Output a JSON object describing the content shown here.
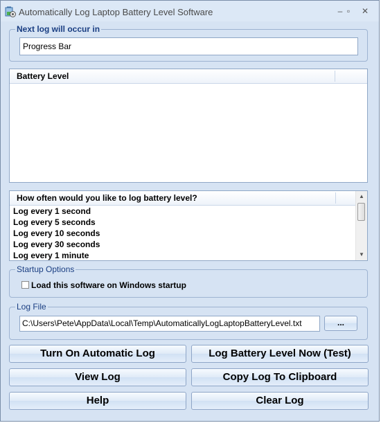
{
  "window": {
    "title": "Automatically Log Laptop Battery Level Software",
    "minimize_glyph": "–",
    "maximize_glyph": "▫",
    "close_glyph": "✕"
  },
  "next_log": {
    "label": "Next log will occur in",
    "value": "Progress Bar"
  },
  "battery_list": {
    "header": "Battery Level",
    "rows": []
  },
  "interval_list": {
    "header": "How often would you like to log battery level?",
    "items": [
      "Log every 1 second",
      "Log every 5 seconds",
      "Log every 10 seconds",
      "Log every 30 seconds",
      "Log every 1 minute"
    ]
  },
  "startup": {
    "label": "Startup Options",
    "checkbox_label": "Load this software on Windows startup",
    "checked": false
  },
  "log_file": {
    "label": "Log File",
    "path": "C:\\Users\\Pete\\AppData\\Local\\Temp\\AutomaticallyLogLaptopBatteryLevel.txt",
    "browse_label": "..."
  },
  "buttons": {
    "turn_on": "Turn On Automatic Log",
    "log_now": "Log Battery Level Now (Test)",
    "view_log": "View Log",
    "copy_log": "Copy Log To Clipboard",
    "help": "Help",
    "clear_log": "Clear Log"
  },
  "icons": {
    "app": "battery-gear-icon",
    "scroll_up": "scroll-up-arrow-icon",
    "scroll_down": "scroll-down-arrow-icon"
  },
  "colors": {
    "window_bg": "#d6e3f3",
    "group_label": "#1a3e82",
    "border": "#9db3d1"
  }
}
